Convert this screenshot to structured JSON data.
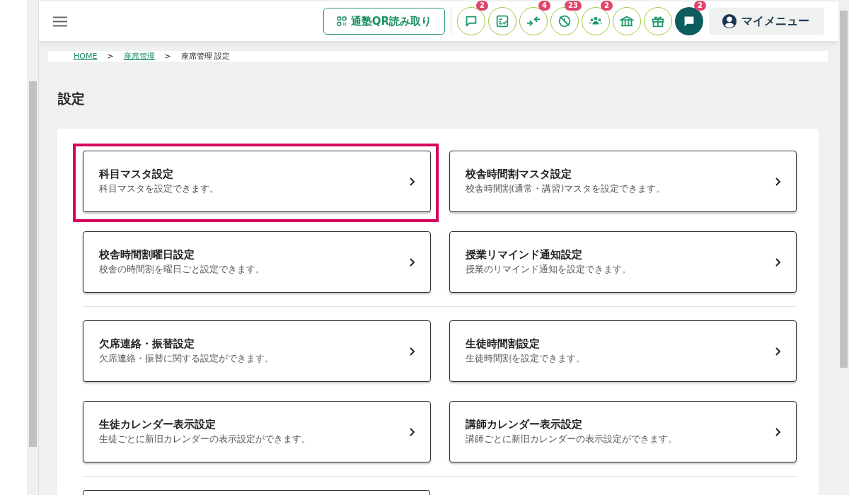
{
  "header": {
    "qr_button": "通塾QR読み取り",
    "icons": [
      {
        "kind": "outline",
        "badge": "2"
      },
      {
        "kind": "outline"
      },
      {
        "kind": "outline",
        "badge": "4"
      },
      {
        "kind": "outline",
        "badge": "23"
      },
      {
        "kind": "outline",
        "badge": "2"
      },
      {
        "kind": "outline"
      },
      {
        "kind": "outline"
      },
      {
        "kind": "filled",
        "badge": "2"
      }
    ],
    "my_menu": "マイメニュー"
  },
  "breadcrumb": [
    {
      "label": "HOME",
      "link": true
    },
    {
      "label": "座席管理",
      "link": true
    },
    {
      "label": "座席管理 設定",
      "link": false
    }
  ],
  "breadcrumb_separator": ">",
  "page_title": "設定",
  "sections": [
    {
      "cards": [
        {
          "title": "科目マスタ設定",
          "description": "科目マスタを設定できます。",
          "highlighted": true
        },
        {
          "title": "校舎時間割マスタ設定",
          "description": "校舎時間割(通常・講習)マスタを設定できます。",
          "highlighted": false
        },
        {
          "title": "校舎時間割曜日設定",
          "description": "校舎の時間割を曜日ごと設定できます。",
          "highlighted": false
        },
        {
          "title": "授業リマインド通知設定",
          "description": "授業のリマインド通知を設定できます。",
          "highlighted": false
        }
      ]
    },
    {
      "cards": [
        {
          "title": "欠席連絡・振替設定",
          "description": "欠席連絡・振替に関する設定ができます。",
          "highlighted": false
        },
        {
          "title": "生徒時間割設定",
          "description": "生徒時間割を設定できます。",
          "highlighted": false
        },
        {
          "title": "生徒カレンダー表示設定",
          "description": "生徒ごとに新旧カレンダーの表示設定ができます。",
          "highlighted": false
        },
        {
          "title": "講師カレンダー表示設定",
          "description": "講師ごとに新旧カレンダーの表示設定ができます。",
          "highlighted": false
        }
      ]
    }
  ]
}
